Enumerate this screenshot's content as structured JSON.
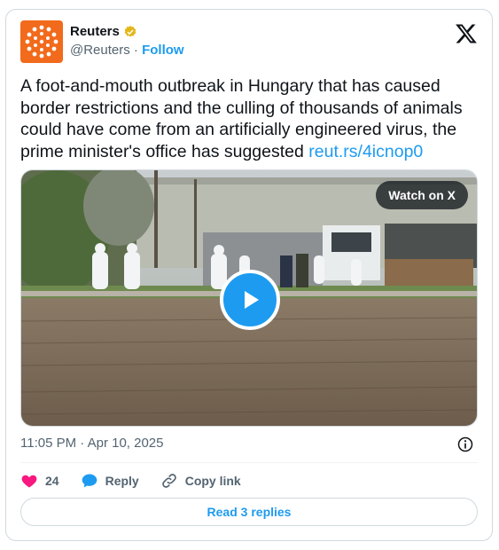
{
  "account": {
    "display_name": "Reuters",
    "handle": "@Reuters",
    "separator": " · ",
    "follow_label": "Follow",
    "verified": true
  },
  "tweet": {
    "text": "A foot-and-mouth outbreak in Hungary that has caused border restrictions and the culling of thousands of animals could have come from an artificially engineered virus, the prime minister's office has suggested ",
    "link": "reut.rs/4icnop0"
  },
  "media": {
    "watch_label": "Watch on X",
    "icon": "play-icon"
  },
  "meta": {
    "timestamp": "11:05 PM · Apr 10, 2025"
  },
  "actions": {
    "like_count": "24",
    "reply_label": "Reply",
    "copy_label": "Copy link"
  },
  "replies": {
    "label": "Read 3 replies"
  },
  "colors": {
    "accent": "#1d9bf0",
    "like": "#f91880",
    "avatar_bg": "#f26a1b",
    "text_primary": "#0f1419",
    "text_secondary": "#536471"
  }
}
